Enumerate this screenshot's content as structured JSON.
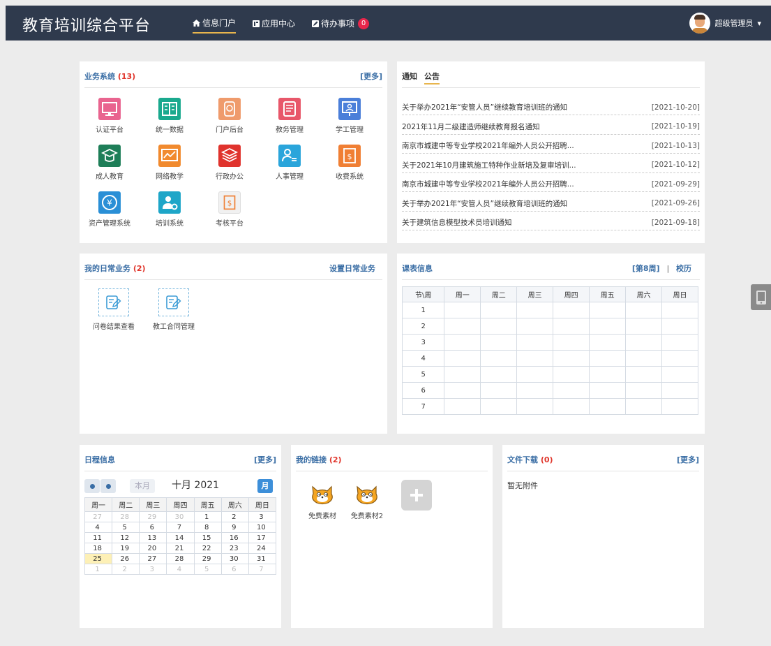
{
  "header": {
    "title": "教育培训综合平台",
    "nav": [
      {
        "icon": "home-icon",
        "label": "信息门户"
      },
      {
        "icon": "apps-icon",
        "label": "应用中心"
      },
      {
        "icon": "edit-icon",
        "label": "待办事项",
        "badge": "0"
      }
    ],
    "user": "超级管理员",
    "user_caret": "▾"
  },
  "business": {
    "title": "业务系统",
    "count": "(13)",
    "more": "[更多]",
    "items": [
      {
        "label": "认证平台",
        "icon": "monitor-icon",
        "color": "#e9648f"
      },
      {
        "label": "统一数据",
        "icon": "book-icon",
        "color": "#1aa98e"
      },
      {
        "label": "门户后台",
        "icon": "tag-icon",
        "color": "#ef9b6c"
      },
      {
        "label": "教务管理",
        "icon": "scroll-icon",
        "color": "#e8576a"
      },
      {
        "label": "学工管理",
        "icon": "presenter-icon",
        "color": "#4b7fd9"
      },
      {
        "label": "成人教育",
        "icon": "graduation-icon",
        "color": "#1e7e58"
      },
      {
        "label": "网络教学",
        "icon": "chart-board-icon",
        "color": "#f18a2e"
      },
      {
        "label": "行政办公",
        "icon": "layers-icon",
        "color": "#e0332d"
      },
      {
        "label": "人事管理",
        "icon": "user-list-icon",
        "color": "#2aa5db"
      },
      {
        "label": "收费系统",
        "icon": "bill-icon",
        "color": "#f07f34"
      },
      {
        "label": "资产管理系统",
        "icon": "yen-icon",
        "color": "#2a8fd6"
      },
      {
        "label": "培训系统",
        "icon": "user-gear-icon",
        "color": "#1ea6c8"
      },
      {
        "label": "考核平台",
        "icon": "bill-outline-icon",
        "color": "#f1f1f1"
      }
    ]
  },
  "notice": {
    "tab1": "通知",
    "tab2": "公告",
    "items": [
      {
        "text": "关于举办2021年“安管人员”继续教育培训班的通知",
        "date": "[2021-10-20]"
      },
      {
        "text": "2021年11月二级建造师继续教育报名通知",
        "date": "[2021-10-19]"
      },
      {
        "text": "南京市城建中等专业学校2021年编外人员公开招聘...",
        "date": "[2021-10-13]"
      },
      {
        "text": "关于2021年10月建筑施工特种作业新培及复审培训...",
        "date": "[2021-10-12]"
      },
      {
        "text": "南京市城建中等专业学校2021年编外人员公开招聘...",
        "date": "[2021-09-29]"
      },
      {
        "text": "关于举办2021年“安管人员”继续教育培训班的通知",
        "date": "[2021-09-26]"
      },
      {
        "text": "关于建筑信息模型技术员培训通知",
        "date": "[2021-09-18]"
      }
    ]
  },
  "daily": {
    "title": "我的日常业务",
    "count": "(2)",
    "action": "设置日常业务",
    "items": [
      {
        "label": "问卷结果查看",
        "icon": "form-edit-icon"
      },
      {
        "label": "教工合同管理",
        "icon": "form-edit-icon"
      }
    ]
  },
  "schedule": {
    "title": "课表信息",
    "week": "[第8周]",
    "separator": "|",
    "calendar_link": "校历",
    "headers": [
      "节\\周",
      "周一",
      "周二",
      "周三",
      "周四",
      "周五",
      "周六",
      "周日"
    ],
    "rows": [
      "1",
      "2",
      "3",
      "4",
      "5",
      "6",
      "7"
    ]
  },
  "agenda": {
    "title": "日程信息",
    "more": "[更多]",
    "this_month": "本月",
    "month_label": "十月 2021",
    "view_button": "月",
    "weekdays": [
      "周一",
      "周二",
      "周三",
      "周四",
      "周五",
      "周六",
      "周日"
    ],
    "weeks": [
      [
        {
          "d": "27",
          "o": true
        },
        {
          "d": "28",
          "o": true
        },
        {
          "d": "29",
          "o": true
        },
        {
          "d": "30",
          "o": true
        },
        {
          "d": "1"
        },
        {
          "d": "2"
        },
        {
          "d": "3"
        }
      ],
      [
        {
          "d": "4"
        },
        {
          "d": "5"
        },
        {
          "d": "6"
        },
        {
          "d": "7"
        },
        {
          "d": "8"
        },
        {
          "d": "9"
        },
        {
          "d": "10"
        }
      ],
      [
        {
          "d": "11"
        },
        {
          "d": "12"
        },
        {
          "d": "13"
        },
        {
          "d": "14"
        },
        {
          "d": "15"
        },
        {
          "d": "16"
        },
        {
          "d": "17"
        }
      ],
      [
        {
          "d": "18"
        },
        {
          "d": "19"
        },
        {
          "d": "20"
        },
        {
          "d": "21"
        },
        {
          "d": "22"
        },
        {
          "d": "23"
        },
        {
          "d": "24"
        }
      ],
      [
        {
          "d": "25",
          "today": true
        },
        {
          "d": "26"
        },
        {
          "d": "27"
        },
        {
          "d": "28"
        },
        {
          "d": "29"
        },
        {
          "d": "30"
        },
        {
          "d": "31"
        }
      ],
      [
        {
          "d": "1",
          "o": true
        },
        {
          "d": "2",
          "o": true
        },
        {
          "d": "3",
          "o": true
        },
        {
          "d": "4",
          "o": true
        },
        {
          "d": "5",
          "o": true
        },
        {
          "d": "6",
          "o": true
        },
        {
          "d": "7",
          "o": true
        }
      ]
    ]
  },
  "links": {
    "title": "我的链接",
    "count": "(2)",
    "items": [
      {
        "label": "免费素材",
        "icon": "scratch-cat-icon"
      },
      {
        "label": "免费素材2",
        "icon": "scratch-cat-icon"
      }
    ],
    "add_icon": "plus-icon"
  },
  "files": {
    "title": "文件下载",
    "count": "(0)",
    "more": "[更多]",
    "empty": "暂无附件"
  },
  "side_tool": {
    "icon": "tablet-icon"
  }
}
